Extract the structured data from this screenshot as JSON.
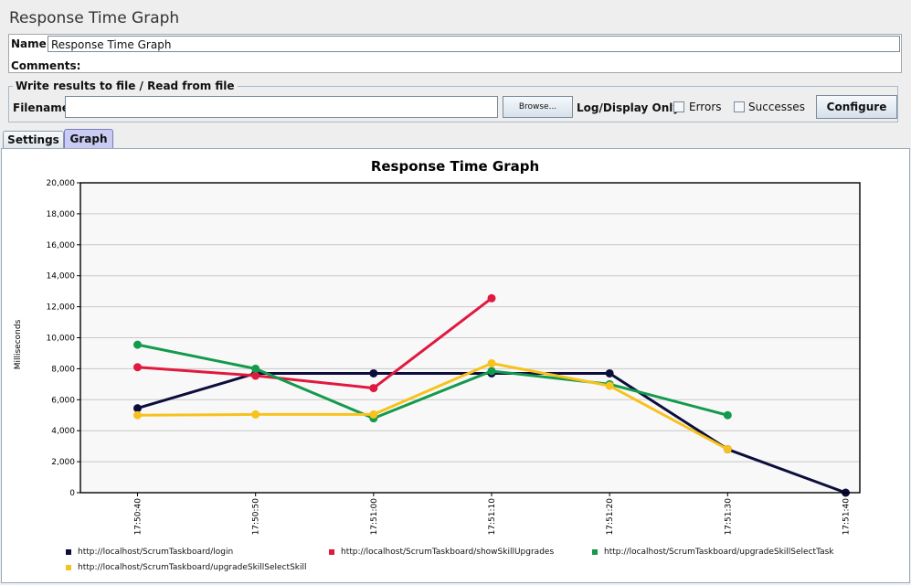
{
  "window": {
    "title": "Response Time Graph"
  },
  "form": {
    "name_label": "Name:",
    "name_value": "Response Time Graph",
    "comments_label": "Comments:",
    "comments_value": ""
  },
  "file_section": {
    "legend": "Write results to file / Read from file",
    "filename_label": "Filename",
    "filename_value": "",
    "browse_label": "Browse...",
    "log_display_label": "Log/Display Only:",
    "errors_label": "Errors",
    "errors_checked": false,
    "successes_label": "Successes",
    "successes_checked": false,
    "configure_label": "Configure"
  },
  "tabs": [
    {
      "label": "Settings",
      "active": false
    },
    {
      "label": "Graph",
      "active": true
    }
  ],
  "chart_data": {
    "type": "line",
    "title": "Response Time Graph",
    "xlabel": "",
    "ylabel": "Milliseconds",
    "ylim": [
      0,
      20000
    ],
    "y_ticks": [
      0,
      2000,
      4000,
      6000,
      8000,
      10000,
      12000,
      14000,
      16000,
      18000,
      20000
    ],
    "y_tick_labels": [
      "0",
      "2,000",
      "4,000",
      "6,000",
      "8,000",
      "10,000",
      "12,000",
      "14,000",
      "16,000",
      "18,000",
      "20,000"
    ],
    "categories": [
      "17:50:40",
      "17:50:50",
      "17:51:00",
      "17:51:10",
      "17:51:20",
      "17:51:30",
      "17:51:40"
    ],
    "grid": true,
    "legend_position": "bottom",
    "series": [
      {
        "name": "http://localhost/ScrumTaskboard/login",
        "color": "#0d0d3d",
        "values": [
          5450,
          7700,
          7700,
          7700,
          7700,
          2800,
          0
        ]
      },
      {
        "name": "http://localhost/ScrumTaskboard/showSkillUpgrades",
        "color": "#e0193f",
        "values": [
          8100,
          7550,
          6750,
          12550,
          null,
          null,
          null
        ]
      },
      {
        "name": "http://localhost/ScrumTaskboard/upgradeSkillSelectTask",
        "color": "#139a4c",
        "values": [
          9550,
          8000,
          4800,
          7850,
          7000,
          5000,
          null
        ]
      },
      {
        "name": "http://localhost/ScrumTaskboard/upgradeSkillSelectSkill",
        "color": "#f7c21e",
        "values": [
          5000,
          5050,
          5050,
          8350,
          6900,
          2800,
          null
        ]
      }
    ]
  }
}
